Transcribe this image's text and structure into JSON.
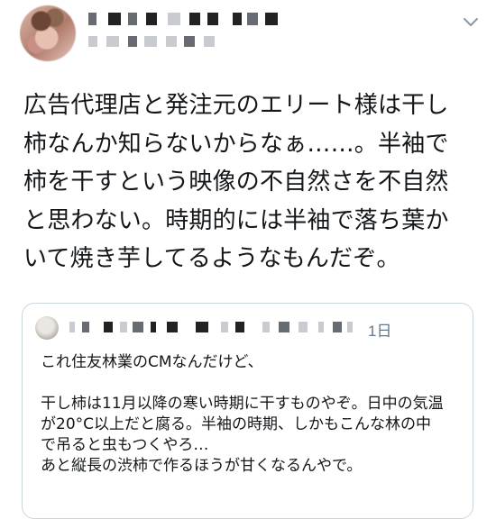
{
  "tweet": {
    "text": "広告代理店と発注元のエリート様は干し\n柿なんか知らないからなぁ……。半袖で\n柿を干すという映像の不自然さを不自然\nと思わない。時期的には半袖で落ち葉か\nいて焼き芋してるようなもんだぞ。",
    "menu_icon": "chevron-down-icon"
  },
  "quoted_tweet": {
    "date": "1日",
    "text": "これ住友林業のCMなんだけど、\n\n干し柿は11月以降の寒い時期に干すものやぞ。日中の気温\nが20°C以上だと腐る。半袖の時期、しかもこんな林の中\nで吊ると虫もつくやろ…\nあと縦長の渋柿で作るほうが甘くなるんやで。"
  },
  "colors": {
    "text": "#14171a",
    "secondary": "#657786",
    "border": "#ccd6dd"
  }
}
